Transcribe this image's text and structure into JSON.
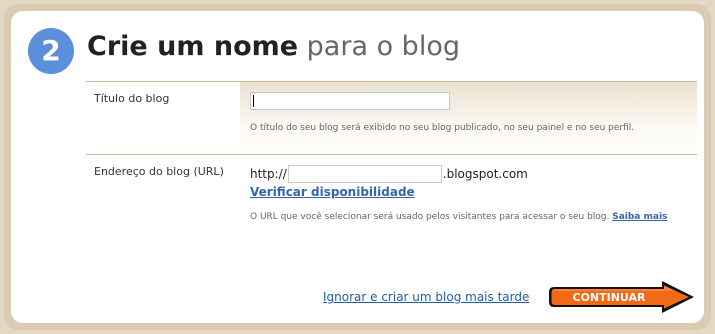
{
  "header": {
    "step_number": "2",
    "title_bold": "Crie um nome",
    "title_light": "para o blog"
  },
  "form": {
    "title_label": "Título do blog",
    "title_value": "",
    "title_hint": "O título do seu blog será exibido no seu blog publicado, no seu painel e no seu perfil.",
    "url_label": "Endereço do blog (URL)",
    "url_prefix": "http://",
    "url_value": "",
    "url_suffix": ".blogspot.com",
    "verify_link": "Verificar disponibilidade",
    "url_hint": "O URL que você selecionar será usado pelos visitantes para acessar o seu blog.",
    "learn_more": "Saiba mais"
  },
  "footer": {
    "skip_link": "Ignorar e criar um blog mais tarde",
    "continue_button": "CONTINUAR"
  },
  "colors": {
    "frame": "#d9ccb2",
    "step_badge": "#5c8ed9",
    "continue_orange": "#f26b14",
    "link": "#3366aa"
  }
}
